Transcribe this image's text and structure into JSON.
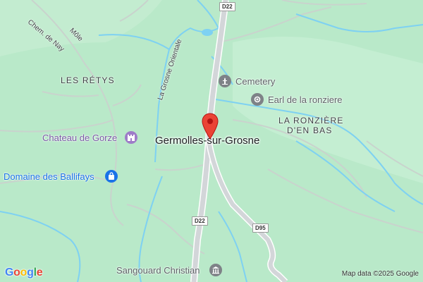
{
  "map": {
    "places": {
      "les_retys": "LES RÉTYS",
      "la_ronziere_line1": "LA RONZIÈRE",
      "la_ronziere_line2": "D'EN BAS"
    },
    "town": "Germolles-sur-Grosne",
    "streets": {
      "chem_de_nay": "Chem. de Nay",
      "mole": "Môle",
      "la_grosne_orientale": "La Grosne Orientale"
    },
    "roads": {
      "d22_top": "D22",
      "d22_bottom": "D22",
      "d95": "D95"
    },
    "pois": {
      "cemetery": "Cemetery",
      "earl": "Earl de la ronziere",
      "chateau": "Chateau de Gorze",
      "domaine": "Domaine des Ballifays",
      "sangouard": "Sangouard Christian"
    },
    "attribution": "Map data ©2025 Google",
    "logo": {
      "g1": "G",
      "o1": "o",
      "o2": "o",
      "g2": "g",
      "l": "l",
      "e": "e"
    },
    "colors": {
      "land": "#b9e9c9",
      "water": "#7ed1f2",
      "road": "#d3d6d9",
      "marker": "#ea4335",
      "poi_gray": "#5f6368",
      "poi_purple": "#7b5aa6",
      "poi_blue": "#1a73e8"
    }
  }
}
